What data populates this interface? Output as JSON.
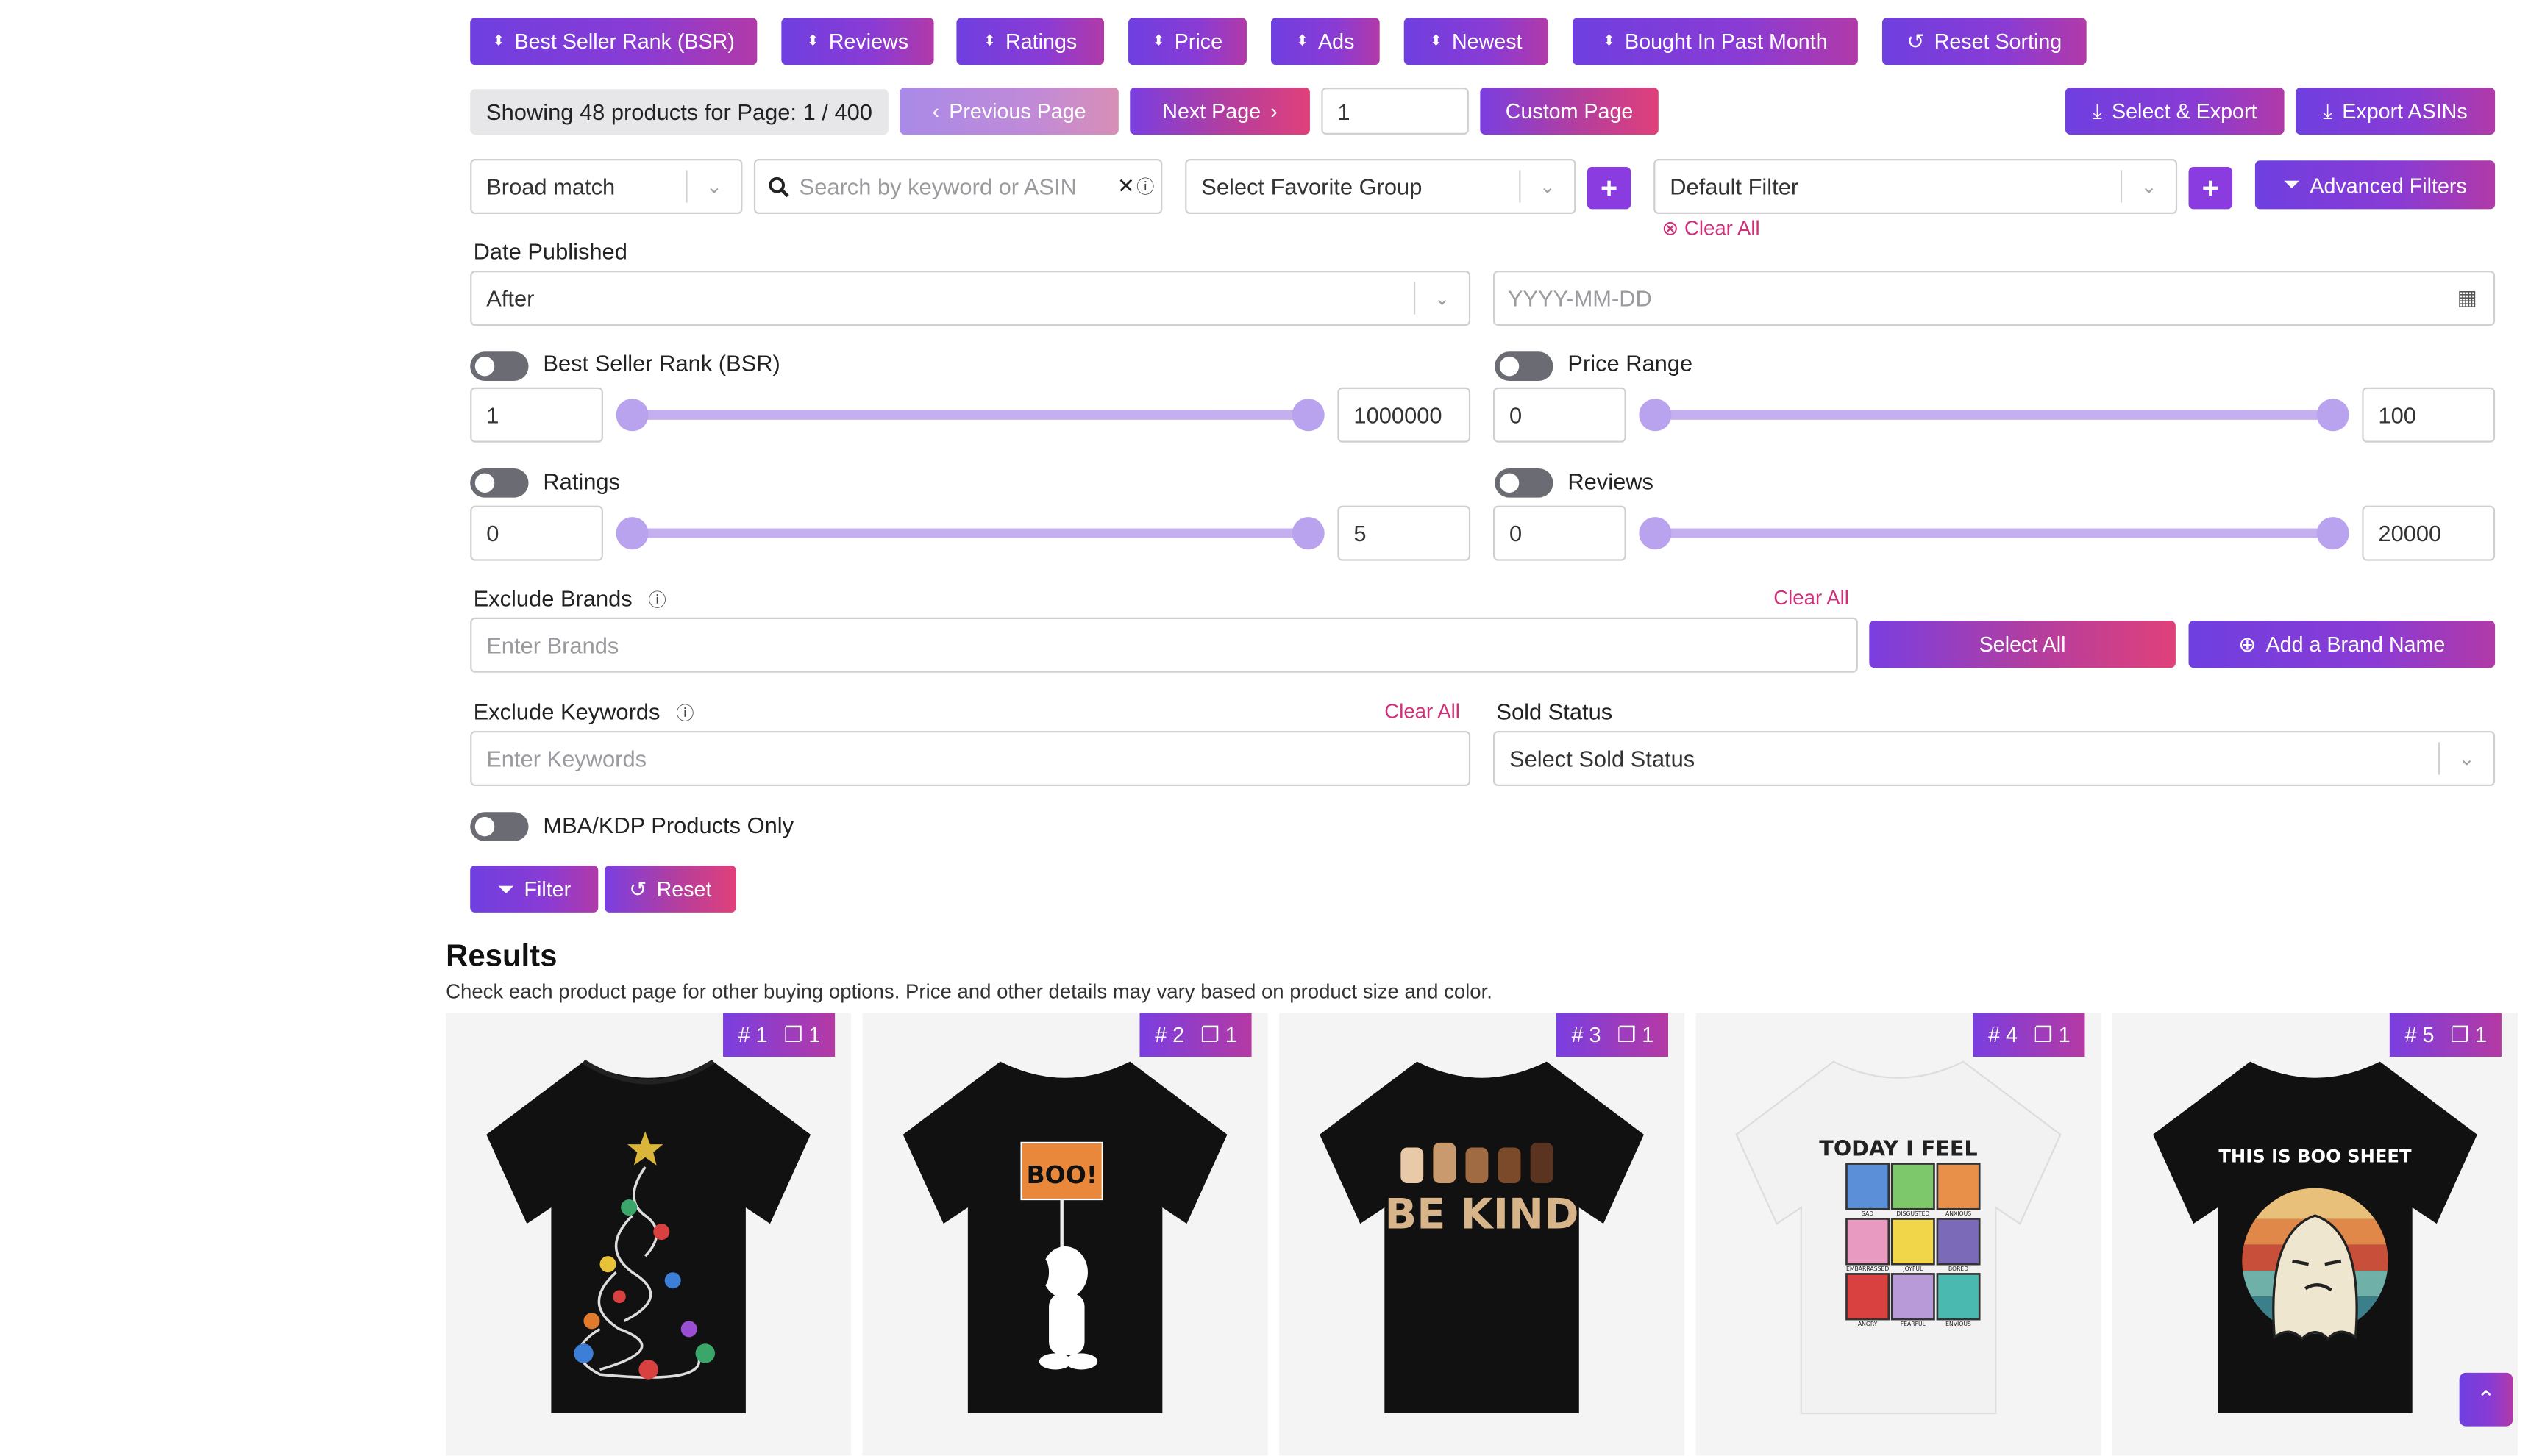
{
  "sort_buttons": [
    {
      "label": "Best Seller Rank (BSR)"
    },
    {
      "label": "Reviews"
    },
    {
      "label": "Ratings"
    },
    {
      "label": "Price"
    },
    {
      "label": "Ads"
    },
    {
      "label": "Newest"
    },
    {
      "label": "Bought In Past Month"
    }
  ],
  "reset_sorting_label": "Reset Sorting",
  "pagination": {
    "showing_text": "Showing 48 products for Page: 1 / 400",
    "prev_label": "Previous Page",
    "next_label": "Next Page",
    "page_input_value": "1",
    "custom_page_label": "Custom Page"
  },
  "export": {
    "select_export_label": "Select & Export",
    "export_asins_label": "Export ASINs"
  },
  "search_row": {
    "match_type": "Broad match",
    "search_placeholder": "Search by keyword or ASIN",
    "favorite_group": "Select Favorite Group",
    "filter_select": "Default Filter",
    "clear_all_label": "Clear All",
    "advanced_filters_label": "Advanced Filters"
  },
  "date_published": {
    "label": "Date Published",
    "mode": "After",
    "date_placeholder": "YYYY-MM-DD"
  },
  "ranges": {
    "bsr": {
      "label": "Best Seller Rank (BSR)",
      "min": "1",
      "max": "1000000",
      "enabled": false
    },
    "price": {
      "label": "Price Range",
      "min": "0",
      "max": "100",
      "enabled": false
    },
    "ratings": {
      "label": "Ratings",
      "min": "0",
      "max": "5",
      "enabled": false
    },
    "reviews": {
      "label": "Reviews",
      "min": "0",
      "max": "20000",
      "enabled": false
    }
  },
  "exclude_brands": {
    "label": "Exclude Brands",
    "clear_all": "Clear All",
    "placeholder": "Enter Brands",
    "select_all_label": "Select All",
    "add_brand_label": "Add a Brand Name"
  },
  "exclude_keywords": {
    "label": "Exclude Keywords",
    "clear_all": "Clear All",
    "placeholder": "Enter Keywords"
  },
  "sold_status": {
    "label": "Sold Status",
    "value": "Select Sold Status"
  },
  "mba_toggle": {
    "label": "MBA/KDP Products Only",
    "enabled": false
  },
  "actions": {
    "filter_label": "Filter",
    "reset_label": "Reset"
  },
  "results": {
    "heading": "Results",
    "subtext": "Check each product page for other buying options. Price and other details may vary based on product size and color.",
    "cards": [
      {
        "rank": "# 1",
        "count": "1",
        "shirt_color": "#111111",
        "design": "dna-christmas-tree-icon"
      },
      {
        "rank": "# 2",
        "count": "1",
        "shirt_color": "#111111",
        "design": "boo-sign-dog-icon",
        "print_text": "BOO!"
      },
      {
        "rank": "# 3",
        "count": "1",
        "shirt_color": "#111111",
        "design": "be-kind-hands-icon",
        "print_text": "BE KIND"
      },
      {
        "rank": "# 4",
        "count": "1",
        "shirt_color": "#f2f2f2",
        "design": "today-i-feel-grid-icon",
        "print_text": "TODAY I FEEL",
        "grid_labels": [
          "SAD",
          "DISGUSTED",
          "ANXIOUS",
          "EMBARRASSED",
          "JOYFUL",
          "BORED",
          "ANGRY",
          "FEARFUL",
          "ENVIOUS"
        ]
      },
      {
        "rank": "# 5",
        "count": "1",
        "shirt_color": "#111111",
        "design": "boo-sheet-ghost-icon",
        "print_text": "THIS IS BOO SHEET"
      }
    ]
  },
  "colors": {
    "accent_purple": "#7a3ee0",
    "accent_pink": "#d0307a",
    "slider": "#b9a3ee"
  }
}
